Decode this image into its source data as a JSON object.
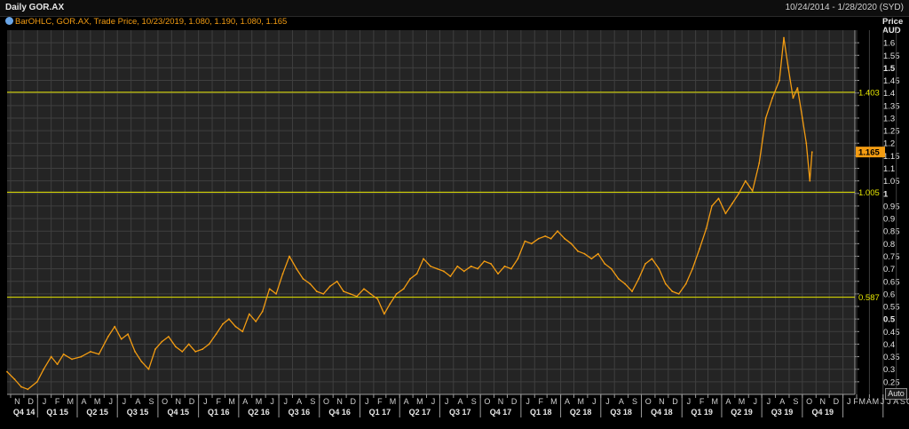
{
  "header": {
    "title": "Daily GOR.AX",
    "date_range": "10/24/2014 - 1/28/2020 (SYD)"
  },
  "legend": {
    "text": "BarOHLC, GOR.AX, Trade Price, 10/23/2019, 1.080, 1.190, 1.080, 1.165"
  },
  "controls": {
    "auto_label": "Auto"
  },
  "colors": {
    "background": "#000000",
    "plot_background": "#242424",
    "grid": "#3f3f3f",
    "series": "#f39c12",
    "hline": "#e6e600",
    "last_price_tag": "#f39c12"
  },
  "chart_data": {
    "type": "line",
    "y_axis_title": [
      "Price",
      "AUD"
    ],
    "ylim": [
      0.2,
      1.65
    ],
    "y_ticks": [
      0.25,
      0.3,
      0.35,
      0.4,
      0.45,
      0.5,
      0.55,
      0.6,
      0.65,
      0.7,
      0.75,
      0.8,
      0.85,
      0.9,
      0.95,
      1,
      1.05,
      1.1,
      1.15,
      1.2,
      1.25,
      1.3,
      1.35,
      1.4,
      1.45,
      1.5,
      1.55,
      1.6
    ],
    "y_tick_labels": [
      "0.25",
      "0.3",
      "0.35",
      "0.4",
      "0.45",
      "0.5",
      "0.55",
      "0.6",
      "0.65",
      "0.7",
      "0.75",
      "0.8",
      "0.85",
      "0.9",
      "0.95",
      "1",
      "1.05",
      "1.1",
      "1.15",
      "1.2",
      "1.25",
      "1.3",
      "1.35",
      "1.4",
      "1.45",
      "1.5",
      "1.55",
      "1.6"
    ],
    "bold_y_ticks": [
      "0.5",
      "1",
      "1.5"
    ],
    "last_price": 1.165,
    "last_price_label": "1.165",
    "horizontal_lines": [
      {
        "value": 1.403,
        "label": "1.403"
      },
      {
        "value": 1.005,
        "label": "1.005"
      },
      {
        "value": 0.587,
        "label": "0.587"
      }
    ],
    "x_range": [
      "2014-10-24",
      "2020-01-28"
    ],
    "month_labels": [
      "N",
      "D",
      "J",
      "F",
      "M",
      "A",
      "M",
      "J",
      "J",
      "A",
      "S",
      "O",
      "N",
      "D",
      "J",
      "F",
      "M",
      "A",
      "M",
      "J",
      "J",
      "A",
      "S",
      "O",
      "N",
      "D",
      "J",
      "F",
      "M",
      "A",
      "M",
      "J",
      "J",
      "A",
      "S",
      "O",
      "N",
      "D",
      "J",
      "F",
      "M",
      "A",
      "M",
      "J",
      "J",
      "A",
      "S",
      "O",
      "N",
      "D",
      "J",
      "F",
      "M",
      "A",
      "M",
      "J",
      "J",
      "A",
      "S",
      "O",
      "N",
      "D",
      "J",
      "F",
      "M",
      "A",
      "M",
      "J",
      "J",
      "A",
      "S",
      "O",
      "N",
      "D",
      "J"
    ],
    "quarter_labels": [
      "Q4 14",
      "Q1 15",
      "Q2 15",
      "Q3 15",
      "Q4 15",
      "Q1 16",
      "Q2 16",
      "Q3 16",
      "Q4 16",
      "Q1 17",
      "Q2 17",
      "Q3 17",
      "Q4 17",
      "Q1 18",
      "Q2 18",
      "Q3 18",
      "Q4 18",
      "Q1 19",
      "Q2 19",
      "Q3 19",
      "Q4 19"
    ],
    "series": [
      {
        "points": [
          [
            "2014-10-24",
            0.29
          ],
          [
            "2014-11-10",
            0.26
          ],
          [
            "2014-11-25",
            0.23
          ],
          [
            "2014-12-10",
            0.22
          ],
          [
            "2014-12-31",
            0.25
          ],
          [
            "2015-01-15",
            0.3
          ],
          [
            "2015-02-01",
            0.35
          ],
          [
            "2015-02-15",
            0.32
          ],
          [
            "2015-03-01",
            0.36
          ],
          [
            "2015-03-20",
            0.34
          ],
          [
            "2015-04-10",
            0.35
          ],
          [
            "2015-05-01",
            0.37
          ],
          [
            "2015-05-20",
            0.36
          ],
          [
            "2015-06-10",
            0.43
          ],
          [
            "2015-06-25",
            0.47
          ],
          [
            "2015-07-10",
            0.42
          ],
          [
            "2015-07-25",
            0.44
          ],
          [
            "2015-08-10",
            0.37
          ],
          [
            "2015-08-25",
            0.33
          ],
          [
            "2015-09-10",
            0.3
          ],
          [
            "2015-09-25",
            0.38
          ],
          [
            "2015-10-10",
            0.41
          ],
          [
            "2015-10-25",
            0.43
          ],
          [
            "2015-11-10",
            0.39
          ],
          [
            "2015-11-25",
            0.37
          ],
          [
            "2015-12-10",
            0.4
          ],
          [
            "2015-12-25",
            0.37
          ],
          [
            "2016-01-10",
            0.38
          ],
          [
            "2016-01-25",
            0.4
          ],
          [
            "2016-02-10",
            0.44
          ],
          [
            "2016-02-25",
            0.48
          ],
          [
            "2016-03-10",
            0.5
          ],
          [
            "2016-03-25",
            0.47
          ],
          [
            "2016-04-10",
            0.45
          ],
          [
            "2016-04-25",
            0.52
          ],
          [
            "2016-05-10",
            0.49
          ],
          [
            "2016-05-25",
            0.53
          ],
          [
            "2016-06-10",
            0.62
          ],
          [
            "2016-06-25",
            0.6
          ],
          [
            "2016-07-10",
            0.68
          ],
          [
            "2016-07-25",
            0.75
          ],
          [
            "2016-08-10",
            0.7
          ],
          [
            "2016-08-25",
            0.66
          ],
          [
            "2016-09-10",
            0.64
          ],
          [
            "2016-09-25",
            0.61
          ],
          [
            "2016-10-10",
            0.6
          ],
          [
            "2016-10-25",
            0.63
          ],
          [
            "2016-11-10",
            0.65
          ],
          [
            "2016-11-25",
            0.61
          ],
          [
            "2016-12-10",
            0.6
          ],
          [
            "2016-12-25",
            0.59
          ],
          [
            "2017-01-10",
            0.62
          ],
          [
            "2017-01-25",
            0.6
          ],
          [
            "2017-02-10",
            0.58
          ],
          [
            "2017-02-25",
            0.52
          ],
          [
            "2017-03-10",
            0.56
          ],
          [
            "2017-03-25",
            0.6
          ],
          [
            "2017-04-10",
            0.62
          ],
          [
            "2017-04-25",
            0.66
          ],
          [
            "2017-05-10",
            0.68
          ],
          [
            "2017-05-25",
            0.74
          ],
          [
            "2017-06-10",
            0.71
          ],
          [
            "2017-06-25",
            0.7
          ],
          [
            "2017-07-10",
            0.69
          ],
          [
            "2017-07-25",
            0.67
          ],
          [
            "2017-08-10",
            0.71
          ],
          [
            "2017-08-25",
            0.69
          ],
          [
            "2017-09-10",
            0.71
          ],
          [
            "2017-09-25",
            0.7
          ],
          [
            "2017-10-10",
            0.73
          ],
          [
            "2017-10-25",
            0.72
          ],
          [
            "2017-11-10",
            0.68
          ],
          [
            "2017-11-25",
            0.71
          ],
          [
            "2017-12-10",
            0.7
          ],
          [
            "2017-12-25",
            0.74
          ],
          [
            "2018-01-10",
            0.81
          ],
          [
            "2018-01-25",
            0.8
          ],
          [
            "2018-02-10",
            0.82
          ],
          [
            "2018-02-25",
            0.83
          ],
          [
            "2018-03-10",
            0.82
          ],
          [
            "2018-03-25",
            0.85
          ],
          [
            "2018-04-10",
            0.82
          ],
          [
            "2018-04-25",
            0.8
          ],
          [
            "2018-05-10",
            0.77
          ],
          [
            "2018-05-25",
            0.76
          ],
          [
            "2018-06-10",
            0.74
          ],
          [
            "2018-06-25",
            0.76
          ],
          [
            "2018-07-10",
            0.72
          ],
          [
            "2018-07-25",
            0.7
          ],
          [
            "2018-08-10",
            0.66
          ],
          [
            "2018-08-25",
            0.64
          ],
          [
            "2018-09-10",
            0.61
          ],
          [
            "2018-09-25",
            0.66
          ],
          [
            "2018-10-10",
            0.72
          ],
          [
            "2018-10-25",
            0.74
          ],
          [
            "2018-11-10",
            0.7
          ],
          [
            "2018-11-25",
            0.64
          ],
          [
            "2018-12-10",
            0.61
          ],
          [
            "2018-12-25",
            0.6
          ],
          [
            "2019-01-10",
            0.64
          ],
          [
            "2019-01-25",
            0.7
          ],
          [
            "2019-02-10",
            0.78
          ],
          [
            "2019-02-25",
            0.86
          ],
          [
            "2019-03-10",
            0.95
          ],
          [
            "2019-03-25",
            0.98
          ],
          [
            "2019-04-10",
            0.92
          ],
          [
            "2019-04-25",
            0.96
          ],
          [
            "2019-05-10",
            1.0
          ],
          [
            "2019-05-25",
            1.05
          ],
          [
            "2019-06-10",
            1.01
          ],
          [
            "2019-06-25",
            1.12
          ],
          [
            "2019-07-10",
            1.3
          ],
          [
            "2019-07-25",
            1.38
          ],
          [
            "2019-08-10",
            1.45
          ],
          [
            "2019-08-20",
            1.62
          ],
          [
            "2019-08-30",
            1.5
          ],
          [
            "2019-09-10",
            1.38
          ],
          [
            "2019-09-20",
            1.42
          ],
          [
            "2019-10-01",
            1.3
          ],
          [
            "2019-10-10",
            1.2
          ],
          [
            "2019-10-18",
            1.05
          ],
          [
            "2019-10-23",
            1.165
          ]
        ]
      }
    ]
  }
}
